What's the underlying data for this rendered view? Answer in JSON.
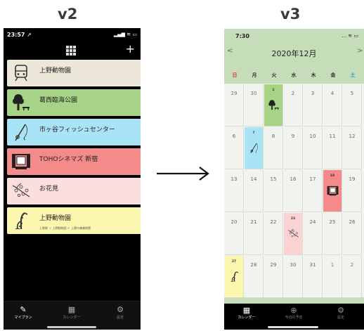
{
  "versions": {
    "left": "v2",
    "right": "v3"
  },
  "left_phone": {
    "status": {
      "time": "23:57 ➚",
      "icons": "▂▄▆ ≋ ▭"
    },
    "header": {
      "grid_icon": "grid-icon",
      "add_symbol": "+"
    },
    "plans": [
      {
        "name": "上野動物園",
        "color": "#ece7d8",
        "icon": "train-icon",
        "sub": ""
      },
      {
        "name": "葛西臨海公園",
        "color": "#a6d385",
        "icon": "park-tree-icon",
        "sub": ""
      },
      {
        "name": "市ヶ谷フィッシュセンター",
        "color": "#a9e4f6",
        "icon": "fishing-rod-icon",
        "sub": ""
      },
      {
        "name": "TOHOシネマズ 新宿",
        "color": "#f48a8a",
        "icon": "cinema-screen-icon",
        "sub": ""
      },
      {
        "name": "お花見",
        "color": "#fbdede",
        "icon": "cherry-blossom-icon",
        "sub": ""
      },
      {
        "name": "上野動物園",
        "color": "#fcf7ae",
        "icon": "giraffe-icon",
        "sub": "上野駅 ＋ 上野動物園 ＋ 上野の森美術館"
      }
    ],
    "tabs": [
      {
        "label": "マイプラン",
        "icon": "pencil-icon",
        "active": true
      },
      {
        "label": "カレンダー",
        "icon": "calendar-icon",
        "active": false
      },
      {
        "label": "設定",
        "icon": "gear-icon",
        "active": false
      }
    ]
  },
  "right_phone": {
    "status": {
      "time": "7:30",
      "icons": "… ≋ ▭"
    },
    "nav": {
      "prev": "<",
      "next": ">"
    },
    "month_title": "2020年12月",
    "weekdays": [
      {
        "label": "日",
        "color": "#e0322f"
      },
      {
        "label": "月",
        "color": "#333333"
      },
      {
        "label": "火",
        "color": "#333333"
      },
      {
        "label": "水",
        "color": "#333333"
      },
      {
        "label": "木",
        "color": "#333333"
      },
      {
        "label": "金",
        "color": "#333333"
      },
      {
        "label": "土",
        "color": "#1e9fd6"
      }
    ],
    "weeks": [
      [
        {
          "d": "29",
          "m": true
        },
        {
          "d": "30",
          "m": true
        },
        {
          "d": "1",
          "bg": "#a6d385",
          "icon": "park-tree-icon"
        },
        {
          "d": "2"
        },
        {
          "d": "3"
        },
        {
          "d": "4"
        },
        {
          "d": "5"
        }
      ],
      [
        {
          "d": "6"
        },
        {
          "d": "7",
          "bg": "#a9e4f6",
          "icon": "fishing-rod-icon"
        },
        {
          "d": "8"
        },
        {
          "d": "9"
        },
        {
          "d": "10"
        },
        {
          "d": "11"
        },
        {
          "d": "12"
        }
      ],
      [
        {
          "d": "13"
        },
        {
          "d": "14"
        },
        {
          "d": "15"
        },
        {
          "d": "16"
        },
        {
          "d": "17"
        },
        {
          "d": "18",
          "bg": "#f48a8a",
          "icon": "cinema-screen-icon"
        },
        {
          "d": "19"
        }
      ],
      [
        {
          "d": "20"
        },
        {
          "d": "21"
        },
        {
          "d": "22"
        },
        {
          "d": "23",
          "bg": "#fbd2d2",
          "icon": "cherry-blossom-icon"
        },
        {
          "d": "24"
        },
        {
          "d": "25"
        },
        {
          "d": "26"
        }
      ],
      [
        {
          "d": "27",
          "bg": "#fcf7ae",
          "icon": "giraffe-icon"
        },
        {
          "d": "28"
        },
        {
          "d": "29"
        },
        {
          "d": "30"
        },
        {
          "d": "31"
        },
        {
          "d": "1",
          "m": true
        },
        {
          "d": "2",
          "m": true
        }
      ]
    ],
    "tabs": [
      {
        "label": "カレンダー",
        "icon": "calendar-icon",
        "active": true
      },
      {
        "label": "今日の予定",
        "icon": "plus-circle-icon",
        "active": false
      },
      {
        "label": "設定",
        "icon": "gear-icon",
        "active": false
      }
    ]
  }
}
